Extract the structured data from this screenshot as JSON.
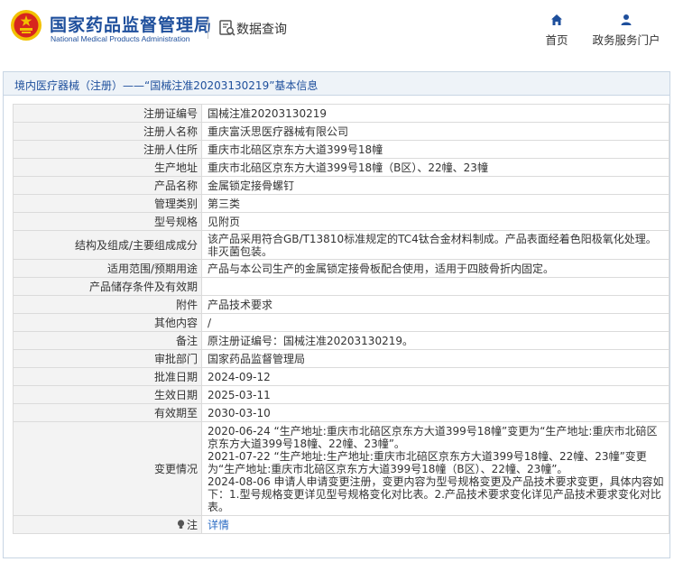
{
  "header": {
    "org_name_cn": "国家药品监督管理局",
    "org_name_en": "National Medical Products Administration",
    "query_label": "数据查询",
    "nav": {
      "home": "首页",
      "gov_portal": "政务服务门户"
    }
  },
  "panel": {
    "title": "境内医疗器械（注册）——“国械注准20203130219”基本信息"
  },
  "rows": [
    {
      "label": "注册证编号",
      "value": "国械注准20203130219"
    },
    {
      "label": "注册人名称",
      "value": "重庆富沃思医疗器械有限公司"
    },
    {
      "label": "注册人住所",
      "value": "重庆市北碚区京东方大道399号18幢"
    },
    {
      "label": "生产地址",
      "value": "重庆市北碚区京东方大道399号18幢（B区）、22幢、23幢"
    },
    {
      "label": "产品名称",
      "value": "金属锁定接骨螺钉"
    },
    {
      "label": "管理类别",
      "value": "第三类"
    },
    {
      "label": "型号规格",
      "value": "见附页"
    },
    {
      "label": "结构及组成/主要组成成分",
      "value": "该产品采用符合GB/T13810标准规定的TC4钛合金材料制成。产品表面经着色阳极氧化处理。非灭菌包装。"
    },
    {
      "label": "适用范围/预期用途",
      "value": "产品与本公司生产的金属锁定接骨板配合使用，适用于四肢骨折内固定。"
    },
    {
      "label": "产品储存条件及有效期",
      "value": ""
    },
    {
      "label": "附件",
      "value": "产品技术要求"
    },
    {
      "label": "其他内容",
      "value": "/"
    },
    {
      "label": "备注",
      "value": "原注册证编号：国械注准20203130219。"
    },
    {
      "label": "审批部门",
      "value": "国家药品监督管理局"
    },
    {
      "label": "批准日期",
      "value": "2024-09-12"
    },
    {
      "label": "生效日期",
      "value": "2025-03-11"
    },
    {
      "label": "有效期至",
      "value": "2030-03-10"
    },
    {
      "label": "变更情况",
      "value": "2020-06-24 “生产地址:重庆市北碚区京东方大道399号18幢”变更为“生产地址:重庆市北碚区京东方大道399号18幢、22幢、23幢”。\n2021-07-22 “生产地址:生产地址:重庆市北碚区京东方大道399号18幢、22幢、23幢”变更为“生产地址:重庆市北碚区京东方大道399号18幢（B区）、22幢、23幢”。\n2024-08-06 申请人申请变更注册，变更内容为型号规格变更及产品技术要求变更，具体内容如下：1.型号规格变更详见型号规格变化对比表。2.产品技术要求变化详见产品技术要求变化对比表。"
    },
    {
      "label": "注",
      "value": "详情"
    }
  ],
  "icons": {
    "emblem": "national-emblem-icon",
    "query": "data-query-icon",
    "home": "home-icon",
    "gov": "user-icon",
    "note": "lightbulb-icon"
  },
  "colors": {
    "brand_blue": "#1e4f9c",
    "emblem_red": "#d7261e",
    "emblem_gold": "#f2c100",
    "link_blue": "#2b6cc4",
    "label_bg": "#f3f3f3",
    "title_bar_bg": "#eef3f8"
  }
}
